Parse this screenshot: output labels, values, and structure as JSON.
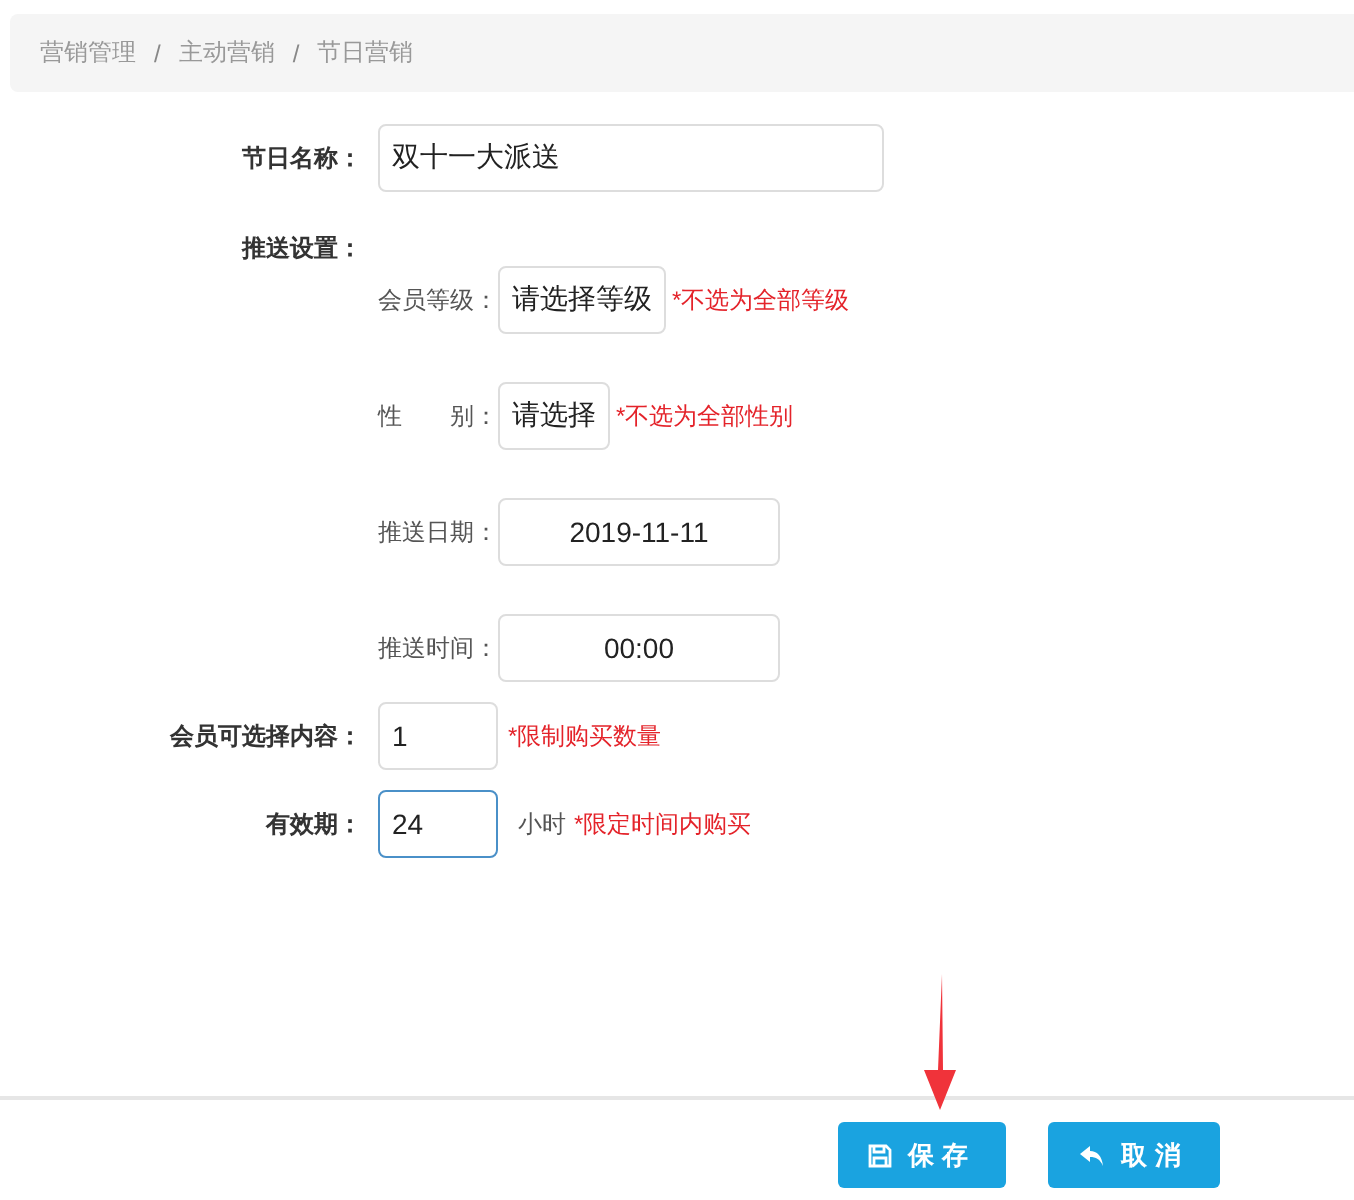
{
  "breadcrumb": {
    "separator": "/",
    "items": [
      {
        "label": "营销管理"
      },
      {
        "label": "主动营销"
      },
      {
        "label": "节日营销"
      }
    ]
  },
  "form": {
    "name": {
      "label": "节日名称：",
      "value": "双十一大派送"
    },
    "push_settings": {
      "label": "推送设置：",
      "items": [
        {
          "kind": "select",
          "label": "会员等级：",
          "value": "请选择等级",
          "hint": "*不选为全部等级"
        },
        {
          "kind": "select",
          "label": "性　　别：",
          "value": "请选择",
          "hint": "*不选为全部性别"
        },
        {
          "kind": "picker",
          "label": "推送日期：",
          "value": "2019-11-11"
        },
        {
          "kind": "picker",
          "label": "推送时间：",
          "value": "00:00"
        }
      ]
    },
    "fields": [
      {
        "label": "会员可选择内容：",
        "value": "1",
        "hint": "*限制购买数量",
        "focused": false
      },
      {
        "label": "有效期：",
        "value": "24",
        "unit": "小时",
        "hint": "*限定时间内购买",
        "focused": true
      }
    ]
  },
  "buttons": [
    {
      "kind": "save",
      "label": "保存"
    },
    {
      "kind": "cancel",
      "label": "取消"
    }
  ],
  "annotation": {
    "kind": "arrow"
  }
}
